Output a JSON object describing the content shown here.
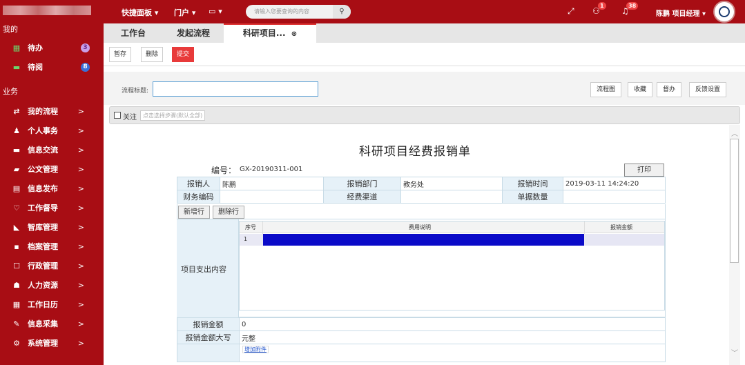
{
  "sidebar": {
    "section_mine": "我的",
    "section_business": "业务",
    "todo": {
      "label": "待办",
      "badge": "3"
    },
    "toread": {
      "label": "待阅",
      "badge": "8"
    },
    "items": [
      {
        "label": "我的流程",
        "icon": "⇄"
      },
      {
        "label": "个人事务",
        "icon": "♟"
      },
      {
        "label": "信息交流",
        "icon": "▬"
      },
      {
        "label": "公文管理",
        "icon": "▰"
      },
      {
        "label": "信息发布",
        "icon": "▤"
      },
      {
        "label": "工作督导",
        "icon": "♡"
      },
      {
        "label": "智库管理",
        "icon": "◣"
      },
      {
        "label": "档案管理",
        "icon": "▪"
      },
      {
        "label": "行政管理",
        "icon": "☐"
      },
      {
        "label": "人力资源",
        "icon": "☗"
      },
      {
        "label": "工作日历",
        "icon": "▦"
      },
      {
        "label": "信息采集",
        "icon": "✎"
      },
      {
        "label": "系统管理",
        "icon": "⚙"
      }
    ],
    "arrow": ">"
  },
  "topbar": {
    "menu1": "快捷面板 ▾",
    "menu2": "门户 ▾",
    "menu3": "▭ ▾",
    "search_placeholder": "请输入您要查询的内容",
    "badge1": "1",
    "badge2": "38",
    "user": "陈鹏 项目经理 ▾"
  },
  "tabs": {
    "t1": "工作台",
    "t2": "发起流程",
    "t3": "科研项目..."
  },
  "actions": {
    "save": "暂存",
    "delete": "删除",
    "submit": "提交"
  },
  "titlerow": {
    "label": "流程标题:",
    "btn1": "流程图",
    "btn2": "收藏",
    "btn3": "督办",
    "btn4": "反馈设置"
  },
  "followbar": {
    "label": "关注",
    "step": "点击选择步骤(默认全部)"
  },
  "form": {
    "title": "科研项目经费报销单",
    "code_label": "编号：",
    "code": "GX-20190311-001",
    "print": "打印",
    "r1": {
      "l1": "报销人",
      "v1": "陈鹏",
      "l2": "报销部门",
      "v2": "教务处",
      "l3": "报销时间",
      "v3": "2019-03-11 14:24:20"
    },
    "r2": {
      "l1": "财务编码",
      "l2": "经费渠道",
      "l3": "单据数量"
    },
    "add_row": "新增行",
    "del_row": "删除行",
    "detail_label": "项目支出内容",
    "col_seq": "序号",
    "col_desc": "费用说明",
    "col_amount": "报销金额",
    "row1_seq": "1",
    "total_label": "报销金额",
    "total_value": "0",
    "upper_label": "报销金额大写",
    "upper_value": "元整",
    "attach": "增加附件"
  }
}
